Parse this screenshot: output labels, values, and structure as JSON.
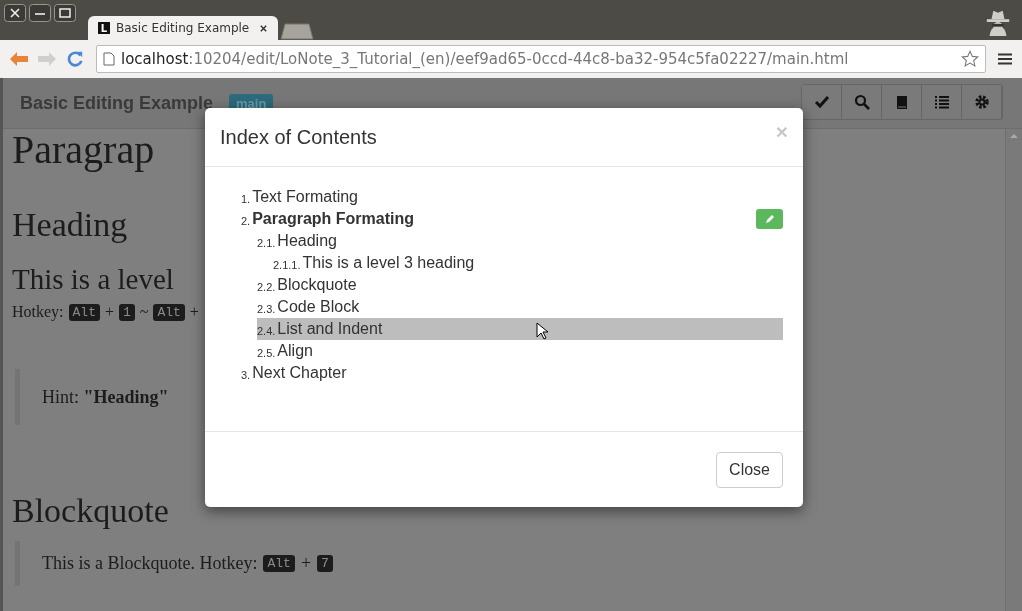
{
  "browser": {
    "tab": {
      "icon_letter": "L",
      "title": "Basic Editing Example"
    },
    "url": {
      "host": "localhost",
      "path": ":10204/edit/LoNote_3_Tutorial_(en)/eef9ad65-0ccd-44c8-ba32-954c5fa02227/main.html"
    }
  },
  "navbar": {
    "title": "Basic Editing Example",
    "badge": "main"
  },
  "page": {
    "heading_1": "Paragrap",
    "heading_2": "Heading",
    "heading_3": "This is a level",
    "hotkey": {
      "label": "Hotkey:",
      "keys": [
        {
          "kind": "key",
          "text": "Alt"
        },
        {
          "kind": "sep",
          "text": "+"
        },
        {
          "kind": "key",
          "text": "1"
        },
        {
          "kind": "sep",
          "text": "~"
        },
        {
          "kind": "key",
          "text": "Alt"
        },
        {
          "kind": "sep",
          "text": "+"
        }
      ]
    },
    "hint": "Hint: **\"Heading\"**",
    "heading_blockquote": "Blockquote",
    "quote": {
      "text": "This is a Blockquote. Hotkey:",
      "keys": [
        {
          "kind": "key",
          "text": "Alt"
        },
        {
          "kind": "sep",
          "text": "+"
        },
        {
          "kind": "key",
          "text": "7"
        }
      ]
    }
  },
  "modal": {
    "title": "Index of Contents",
    "close_icon": "×",
    "items": [
      {
        "number": "1.",
        "label": "Text Formating",
        "current": false,
        "selected": false
      },
      {
        "number": "2.",
        "label": "Paragraph Formating",
        "current": true,
        "selected": false,
        "children": [
          {
            "number": "2.1.",
            "label": "Heading",
            "current": false,
            "selected": false,
            "children": [
              {
                "number": "2.1.1.",
                "label": "This is a level 3 heading",
                "current": false,
                "selected": false
              }
            ]
          },
          {
            "number": "2.2.",
            "label": "Blockquote",
            "current": false,
            "selected": false
          },
          {
            "number": "2.3.",
            "label": "Code Block",
            "current": false,
            "selected": false
          },
          {
            "number": "2.4.",
            "label": "List and Indent",
            "current": false,
            "selected": true
          },
          {
            "number": "2.5.",
            "label": "Align",
            "current": false,
            "selected": false
          }
        ]
      },
      {
        "number": "3.",
        "label": "Next Chapter",
        "current": false,
        "selected": false
      }
    ],
    "button": "Close"
  }
}
